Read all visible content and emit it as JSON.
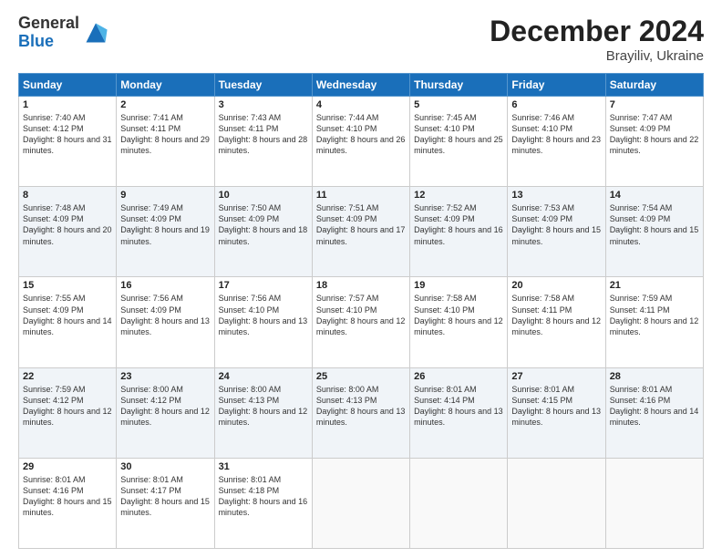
{
  "header": {
    "logo_general": "General",
    "logo_blue": "Blue",
    "month_title": "December 2024",
    "subtitle": "Brayiliv, Ukraine"
  },
  "days_of_week": [
    "Sunday",
    "Monday",
    "Tuesday",
    "Wednesday",
    "Thursday",
    "Friday",
    "Saturday"
  ],
  "weeks": [
    [
      {
        "day": "1",
        "sunrise": "7:40 AM",
        "sunset": "4:12 PM",
        "daylight": "8 hours and 31 minutes."
      },
      {
        "day": "2",
        "sunrise": "7:41 AM",
        "sunset": "4:11 PM",
        "daylight": "8 hours and 29 minutes."
      },
      {
        "day": "3",
        "sunrise": "7:43 AM",
        "sunset": "4:11 PM",
        "daylight": "8 hours and 28 minutes."
      },
      {
        "day": "4",
        "sunrise": "7:44 AM",
        "sunset": "4:10 PM",
        "daylight": "8 hours and 26 minutes."
      },
      {
        "day": "5",
        "sunrise": "7:45 AM",
        "sunset": "4:10 PM",
        "daylight": "8 hours and 25 minutes."
      },
      {
        "day": "6",
        "sunrise": "7:46 AM",
        "sunset": "4:10 PM",
        "daylight": "8 hours and 23 minutes."
      },
      {
        "day": "7",
        "sunrise": "7:47 AM",
        "sunset": "4:09 PM",
        "daylight": "8 hours and 22 minutes."
      }
    ],
    [
      {
        "day": "8",
        "sunrise": "7:48 AM",
        "sunset": "4:09 PM",
        "daylight": "8 hours and 20 minutes."
      },
      {
        "day": "9",
        "sunrise": "7:49 AM",
        "sunset": "4:09 PM",
        "daylight": "8 hours and 19 minutes."
      },
      {
        "day": "10",
        "sunrise": "7:50 AM",
        "sunset": "4:09 PM",
        "daylight": "8 hours and 18 minutes."
      },
      {
        "day": "11",
        "sunrise": "7:51 AM",
        "sunset": "4:09 PM",
        "daylight": "8 hours and 17 minutes."
      },
      {
        "day": "12",
        "sunrise": "7:52 AM",
        "sunset": "4:09 PM",
        "daylight": "8 hours and 16 minutes."
      },
      {
        "day": "13",
        "sunrise": "7:53 AM",
        "sunset": "4:09 PM",
        "daylight": "8 hours and 15 minutes."
      },
      {
        "day": "14",
        "sunrise": "7:54 AM",
        "sunset": "4:09 PM",
        "daylight": "8 hours and 15 minutes."
      }
    ],
    [
      {
        "day": "15",
        "sunrise": "7:55 AM",
        "sunset": "4:09 PM",
        "daylight": "8 hours and 14 minutes."
      },
      {
        "day": "16",
        "sunrise": "7:56 AM",
        "sunset": "4:09 PM",
        "daylight": "8 hours and 13 minutes."
      },
      {
        "day": "17",
        "sunrise": "7:56 AM",
        "sunset": "4:10 PM",
        "daylight": "8 hours and 13 minutes."
      },
      {
        "day": "18",
        "sunrise": "7:57 AM",
        "sunset": "4:10 PM",
        "daylight": "8 hours and 12 minutes."
      },
      {
        "day": "19",
        "sunrise": "7:58 AM",
        "sunset": "4:10 PM",
        "daylight": "8 hours and 12 minutes."
      },
      {
        "day": "20",
        "sunrise": "7:58 AM",
        "sunset": "4:11 PM",
        "daylight": "8 hours and 12 minutes."
      },
      {
        "day": "21",
        "sunrise": "7:59 AM",
        "sunset": "4:11 PM",
        "daylight": "8 hours and 12 minutes."
      }
    ],
    [
      {
        "day": "22",
        "sunrise": "7:59 AM",
        "sunset": "4:12 PM",
        "daylight": "8 hours and 12 minutes."
      },
      {
        "day": "23",
        "sunrise": "8:00 AM",
        "sunset": "4:12 PM",
        "daylight": "8 hours and 12 minutes."
      },
      {
        "day": "24",
        "sunrise": "8:00 AM",
        "sunset": "4:13 PM",
        "daylight": "8 hours and 12 minutes."
      },
      {
        "day": "25",
        "sunrise": "8:00 AM",
        "sunset": "4:13 PM",
        "daylight": "8 hours and 13 minutes."
      },
      {
        "day": "26",
        "sunrise": "8:01 AM",
        "sunset": "4:14 PM",
        "daylight": "8 hours and 13 minutes."
      },
      {
        "day": "27",
        "sunrise": "8:01 AM",
        "sunset": "4:15 PM",
        "daylight": "8 hours and 13 minutes."
      },
      {
        "day": "28",
        "sunrise": "8:01 AM",
        "sunset": "4:16 PM",
        "daylight": "8 hours and 14 minutes."
      }
    ],
    [
      {
        "day": "29",
        "sunrise": "8:01 AM",
        "sunset": "4:16 PM",
        "daylight": "8 hours and 15 minutes."
      },
      {
        "day": "30",
        "sunrise": "8:01 AM",
        "sunset": "4:17 PM",
        "daylight": "8 hours and 15 minutes."
      },
      {
        "day": "31",
        "sunrise": "8:01 AM",
        "sunset": "4:18 PM",
        "daylight": "8 hours and 16 minutes."
      },
      null,
      null,
      null,
      null
    ]
  ]
}
